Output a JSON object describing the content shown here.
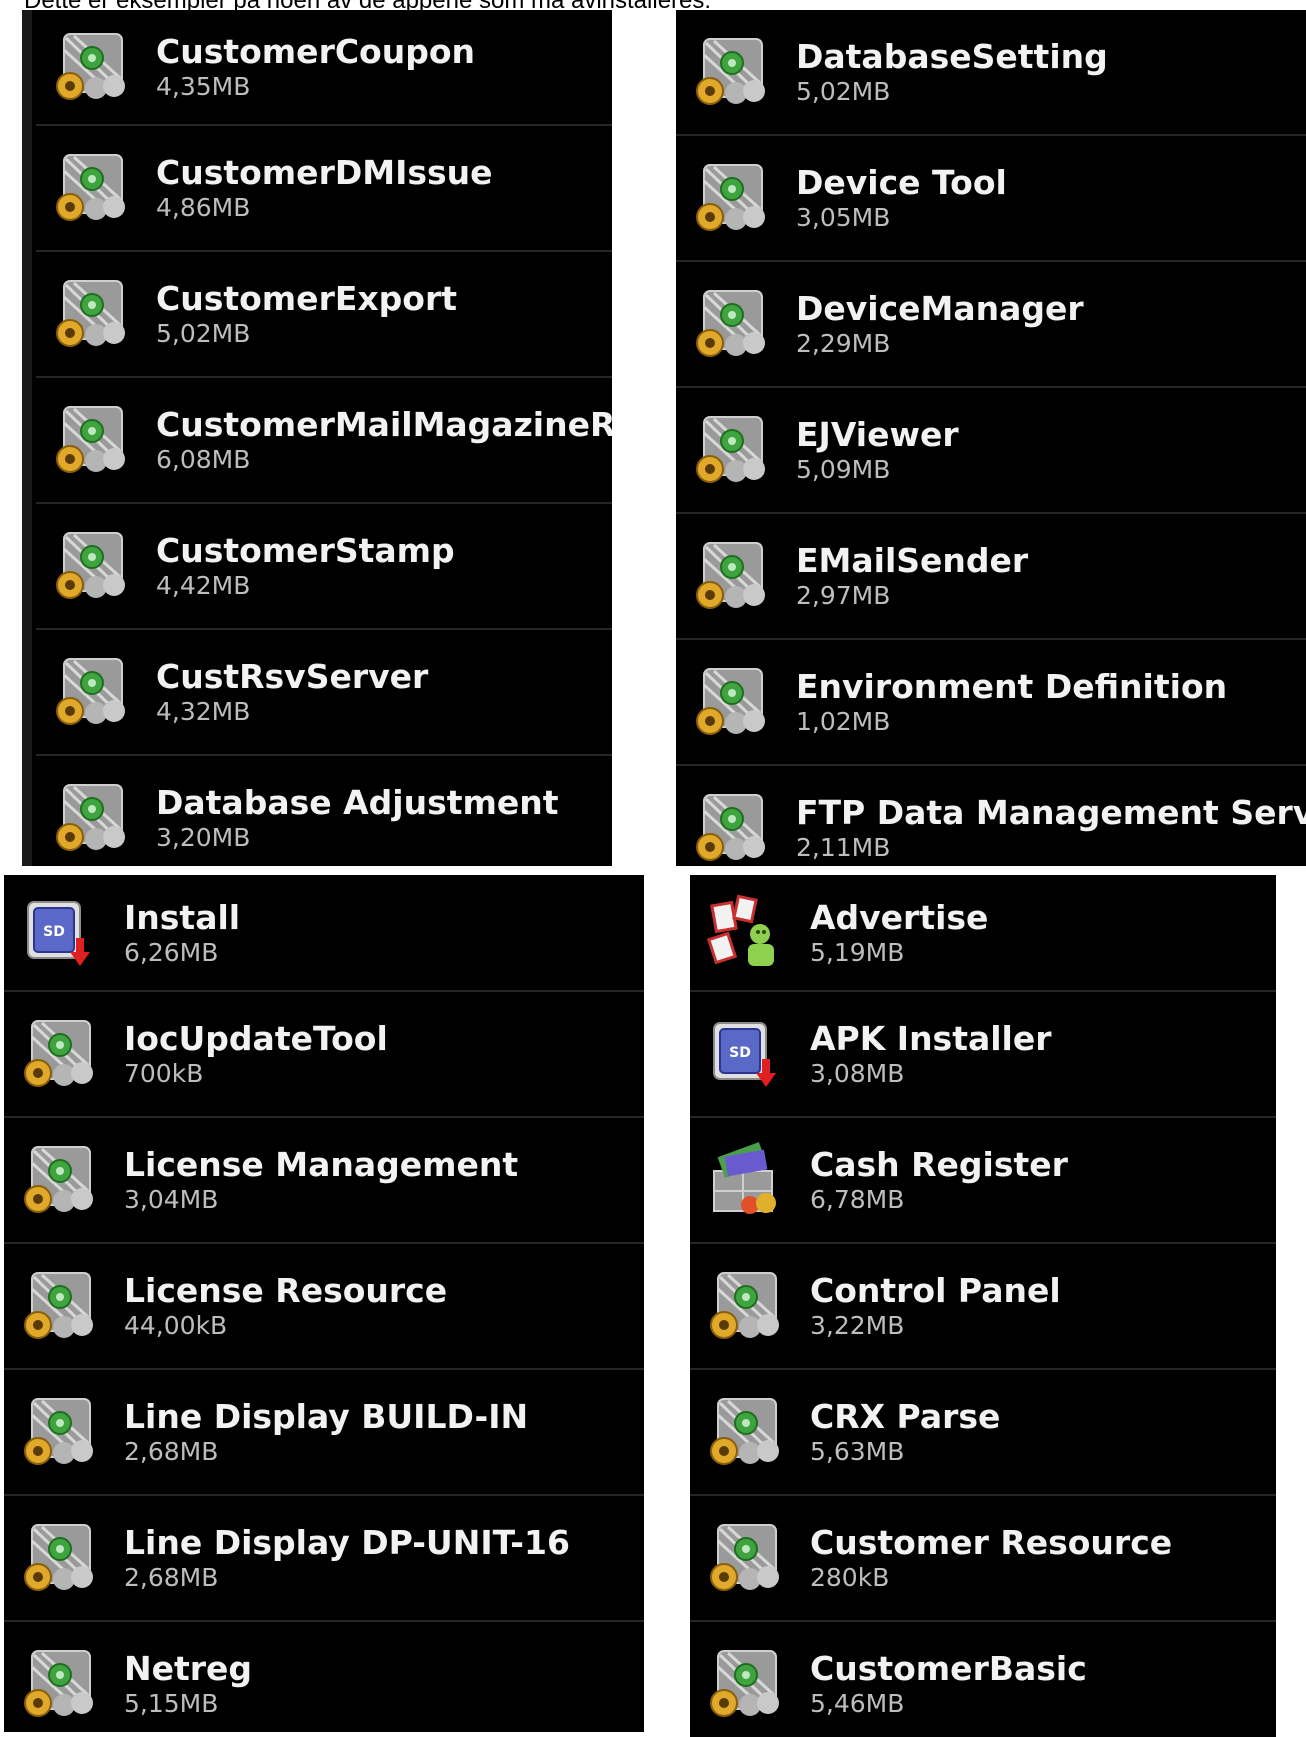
{
  "caption": "Dette er eksempler på noen av de appene som må avinstalleres:",
  "panels": [
    {
      "id": "tl",
      "apps": [
        {
          "name": "CustomerCoupon",
          "size": "4,35MB",
          "icon": "gear-settings-icon"
        },
        {
          "name": "CustomerDMIssue",
          "size": "4,86MB",
          "icon": "gear-settings-icon"
        },
        {
          "name": "CustomerExport",
          "size": "5,02MB",
          "icon": "gear-settings-icon"
        },
        {
          "name": "CustomerMailMagazineReg",
          "size": "6,08MB",
          "icon": "gear-settings-icon"
        },
        {
          "name": "CustomerStamp",
          "size": "4,42MB",
          "icon": "gear-settings-icon"
        },
        {
          "name": "CustRsvServer",
          "size": "4,32MB",
          "icon": "gear-settings-icon"
        },
        {
          "name": "Database Adjustment",
          "size": "3,20MB",
          "icon": "gear-settings-icon"
        }
      ]
    },
    {
      "id": "tr",
      "apps": [
        {
          "name": "DatabaseSetting",
          "size": "5,02MB",
          "icon": "gear-settings-icon"
        },
        {
          "name": "Device Tool",
          "size": "3,05MB",
          "icon": "gear-settings-icon"
        },
        {
          "name": "DeviceManager",
          "size": "2,29MB",
          "icon": "gear-settings-icon"
        },
        {
          "name": "EJViewer",
          "size": "5,09MB",
          "icon": "gear-settings-icon"
        },
        {
          "name": "EMailSender",
          "size": "2,97MB",
          "icon": "gear-settings-icon"
        },
        {
          "name": "Environment Definition",
          "size": "1,02MB",
          "icon": "gear-settings-icon"
        },
        {
          "name": "FTP Data Management Service",
          "size": "2,11MB",
          "icon": "gear-settings-icon"
        }
      ]
    },
    {
      "id": "bl",
      "apps": [
        {
          "name": "Install",
          "size": "6,26MB",
          "icon": "sd-install-icon"
        },
        {
          "name": "IocUpdateTool",
          "size": "700kB",
          "icon": "gear-settings-icon"
        },
        {
          "name": "License Management",
          "size": "3,04MB",
          "icon": "gear-settings-icon"
        },
        {
          "name": "License Resource",
          "size": "44,00kB",
          "icon": "gear-settings-icon"
        },
        {
          "name": "Line Display BUILD-IN",
          "size": "2,68MB",
          "icon": "gear-settings-icon"
        },
        {
          "name": "Line Display DP-UNIT-16",
          "size": "2,68MB",
          "icon": "gear-settings-icon"
        },
        {
          "name": "Netreg",
          "size": "5,15MB",
          "icon": "gear-settings-icon"
        }
      ]
    },
    {
      "id": "br",
      "apps": [
        {
          "name": "Advertise",
          "size": "5,19MB",
          "icon": "advertise-icon"
        },
        {
          "name": "APK Installer",
          "size": "3,08MB",
          "icon": "sd-install-icon"
        },
        {
          "name": "Cash Register",
          "size": "6,78MB",
          "icon": "cash-register-icon"
        },
        {
          "name": "Control Panel",
          "size": "3,22MB",
          "icon": "gear-settings-icon"
        },
        {
          "name": "CRX Parse",
          "size": "5,63MB",
          "icon": "gear-settings-icon"
        },
        {
          "name": "Customer Resource",
          "size": "280kB",
          "icon": "gear-settings-icon"
        },
        {
          "name": "CustomerBasic",
          "size": "5,46MB",
          "icon": "gear-settings-icon"
        }
      ]
    }
  ],
  "sd_label": "SD",
  "colors": {
    "background": "#000000",
    "divider": "#262626",
    "title": "#f2f2f2",
    "subtitle": "#bdbdbd"
  }
}
